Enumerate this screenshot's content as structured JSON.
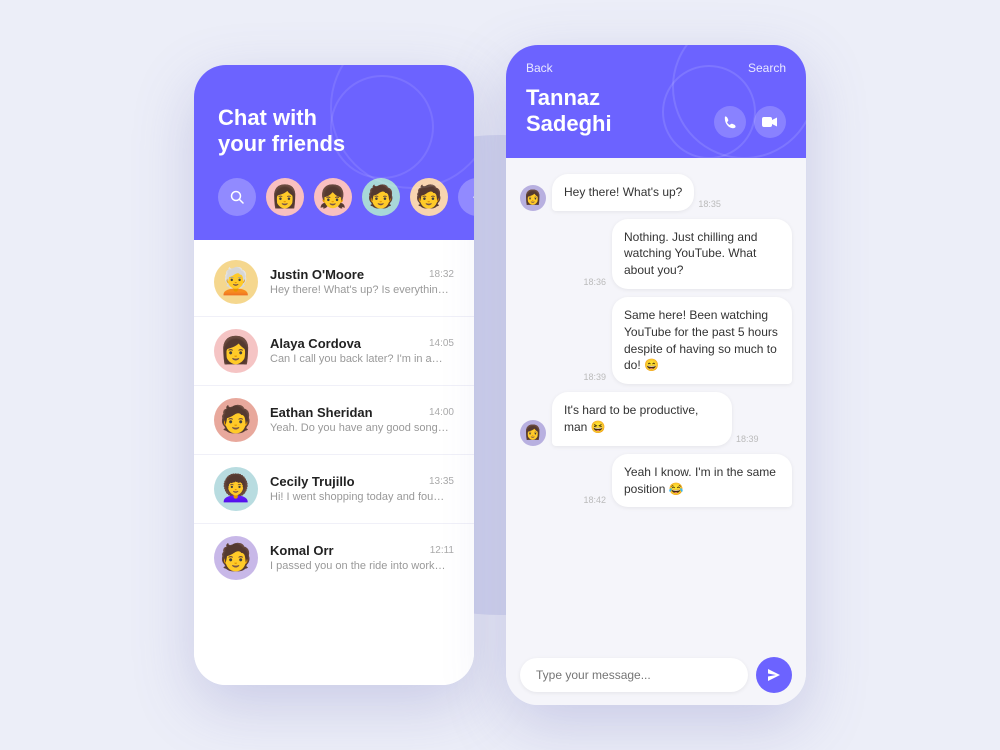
{
  "background": {
    "circle_color": "#c8cae8"
  },
  "phone1": {
    "header": {
      "title_line1": "Chat with",
      "title_line2": "your friends"
    },
    "stories": [
      {
        "type": "search",
        "icon": "🔍"
      },
      {
        "type": "avatar",
        "emoji": "👩",
        "color": "pink",
        "id": "s1"
      },
      {
        "type": "avatar",
        "emoji": "👧",
        "color": "pink",
        "id": "s2"
      },
      {
        "type": "avatar",
        "emoji": "🧑",
        "color": "teal",
        "id": "s3"
      },
      {
        "type": "avatar",
        "emoji": "🧑",
        "color": "peach",
        "id": "s4"
      }
    ],
    "chats": [
      {
        "id": "c1",
        "name": "Justin O'Moore",
        "time": "18:32",
        "preview": "Hey there! What's up? Is everything…",
        "emoji": "🧑‍🦳",
        "avatarColor": "ca-yellow"
      },
      {
        "id": "c2",
        "name": "Alaya Cordova",
        "time": "14:05",
        "preview": "Can I call you back later? I'm in a…",
        "emoji": "👩",
        "avatarColor": "ca-pink"
      },
      {
        "id": "c3",
        "name": "Eathan Sheridan",
        "time": "14:00",
        "preview": "Yeah. Do you have any good song…",
        "emoji": "🧑",
        "avatarColor": "ca-salmon"
      },
      {
        "id": "c4",
        "name": "Cecily Trujillo",
        "time": "13:35",
        "preview": "Hi! I went shopping today and fou…",
        "emoji": "👩‍🦱",
        "avatarColor": "ca-teal"
      },
      {
        "id": "c5",
        "name": "Komal Orr",
        "time": "12:11",
        "preview": "I passed you on the ride into work…",
        "emoji": "🧑",
        "avatarColor": "ca-purple"
      }
    ]
  },
  "phone2": {
    "header": {
      "back_label": "Back",
      "search_label": "Search",
      "contact_name_line1": "Tannaz",
      "contact_name_line2": "Sadeghi",
      "phone_icon": "📞",
      "video_icon": "📹"
    },
    "messages": [
      {
        "id": "m1",
        "type": "received",
        "text": "Hey there! What's up?",
        "time": "18:35",
        "show_avatar": true
      },
      {
        "id": "m2",
        "type": "sent",
        "text": "Nothing. Just chilling and watching YouTube. What about you?",
        "time": "18:36",
        "show_avatar": false
      },
      {
        "id": "m3",
        "type": "sent",
        "text": "Same here! Been watching YouTube for the past 5 hours despite of having so much to do! 😄",
        "time": "18:39",
        "show_avatar": false
      },
      {
        "id": "m4",
        "type": "received",
        "text": "It's hard to be productive, man 😆",
        "time": "18:39",
        "show_avatar": true
      },
      {
        "id": "m5",
        "type": "sent",
        "text": "Yeah I know. I'm in the same position 😂",
        "time": "18:42",
        "show_avatar": false
      }
    ],
    "input": {
      "placeholder": "Type your message...",
      "send_icon": "➤"
    }
  }
}
